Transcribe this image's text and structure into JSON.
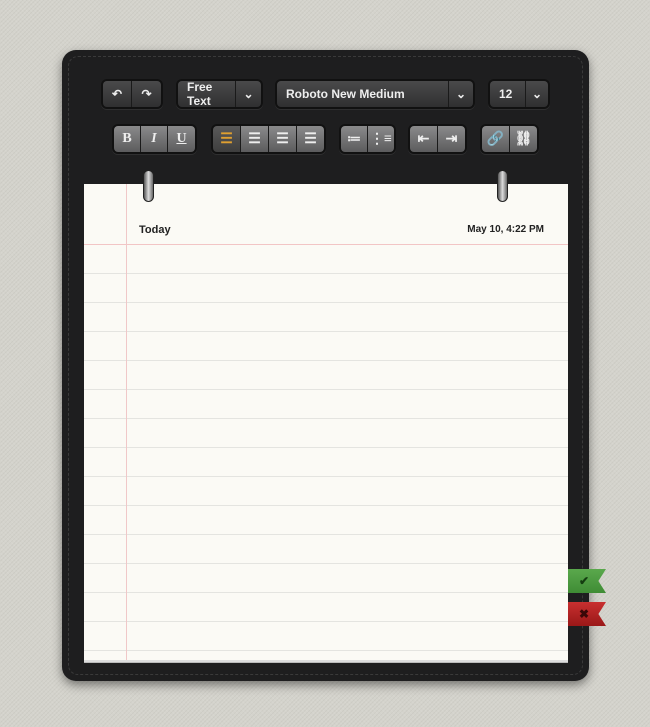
{
  "toolbar": {
    "undo_icon": "undo-arrow-icon",
    "redo_icon": "redo-arrow-icon",
    "mode_select": "Free Text",
    "font_select": "Roboto New Medium",
    "size_select": "12",
    "bold": "B",
    "italic": "I",
    "underline": "U",
    "align_active": "left",
    "accent_color": "#e0a030"
  },
  "note": {
    "title": "Today",
    "timestamp": "May 10, 4:22 PM"
  },
  "flags": {
    "confirm_color": "#3f8c35",
    "cancel_color": "#b02020"
  }
}
